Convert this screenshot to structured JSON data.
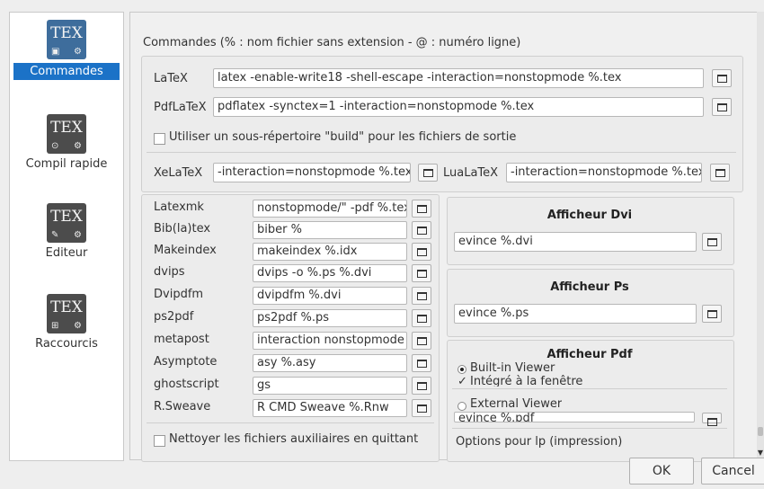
{
  "sidebar": {
    "items": [
      {
        "icon_text": "TEX",
        "label": "Commandes",
        "selected": true
      },
      {
        "icon_text": "TEX",
        "label": "Compil rapide"
      },
      {
        "icon_text": "TEX",
        "label": "Editeur"
      },
      {
        "icon_text": "TEX",
        "label": "Raccourcis"
      }
    ]
  },
  "commands": {
    "header": "Commandes (% : nom fichier sans extension - @ : numéro ligne)",
    "latex": {
      "label": "LaTeX",
      "value": "latex -enable-write18 -shell-escape -interaction=nonstopmode %.tex"
    },
    "pdflatex": {
      "label": "PdfLaTeX",
      "value": "pdflatex -synctex=1 -interaction=nonstopmode %.tex"
    },
    "build_subdir_label": "Utiliser un sous-répertoire \"build\" pour les fichiers de sortie",
    "xelatex": {
      "label": "XeLaTeX",
      "value": "-interaction=nonstopmode %.tex"
    },
    "lualatex": {
      "label": "LuaLaTeX",
      "value": "-interaction=nonstopmode %.tex"
    }
  },
  "tools": [
    {
      "label": "Latexmk",
      "value": "nonstopmode/\" -pdf %.tex"
    },
    {
      "label": "Bib(la)tex",
      "value": "biber %"
    },
    {
      "label": "Makeindex",
      "value": "makeindex %.idx"
    },
    {
      "label": "dvips",
      "value": "dvips -o %.ps %.dvi"
    },
    {
      "label": "Dvipdfm",
      "value": "dvipdfm %.dvi"
    },
    {
      "label": "ps2pdf",
      "value": "ps2pdf %.ps"
    },
    {
      "label": "metapost",
      "value": "interaction nonstopmode"
    },
    {
      "label": "Asymptote",
      "value": "asy %.asy"
    },
    {
      "label": "ghostscript",
      "value": "gs"
    },
    {
      "label": "R.Sweave",
      "value": "R CMD Sweave %.Rnw"
    }
  ],
  "cleanup_label": "Nettoyer les fichiers auxiliaires en quittant",
  "viewers": {
    "dvi": {
      "title": "Afficheur Dvi",
      "value": "evince %.dvi"
    },
    "ps": {
      "title": "Afficheur Ps",
      "value": "evince %.ps"
    },
    "pdf": {
      "title": "Afficheur Pdf",
      "builtin_label": "Built-in Viewer",
      "embedded_label": "Intégré à la fenêtre",
      "external_label": "External Viewer",
      "external_value": "evince %.pdf"
    },
    "print_options_label": "Options pour lp (impression)"
  },
  "buttons": {
    "ok": "OK",
    "cancel": "Cancel"
  },
  "colors": {
    "selection": "#1b72c7"
  }
}
